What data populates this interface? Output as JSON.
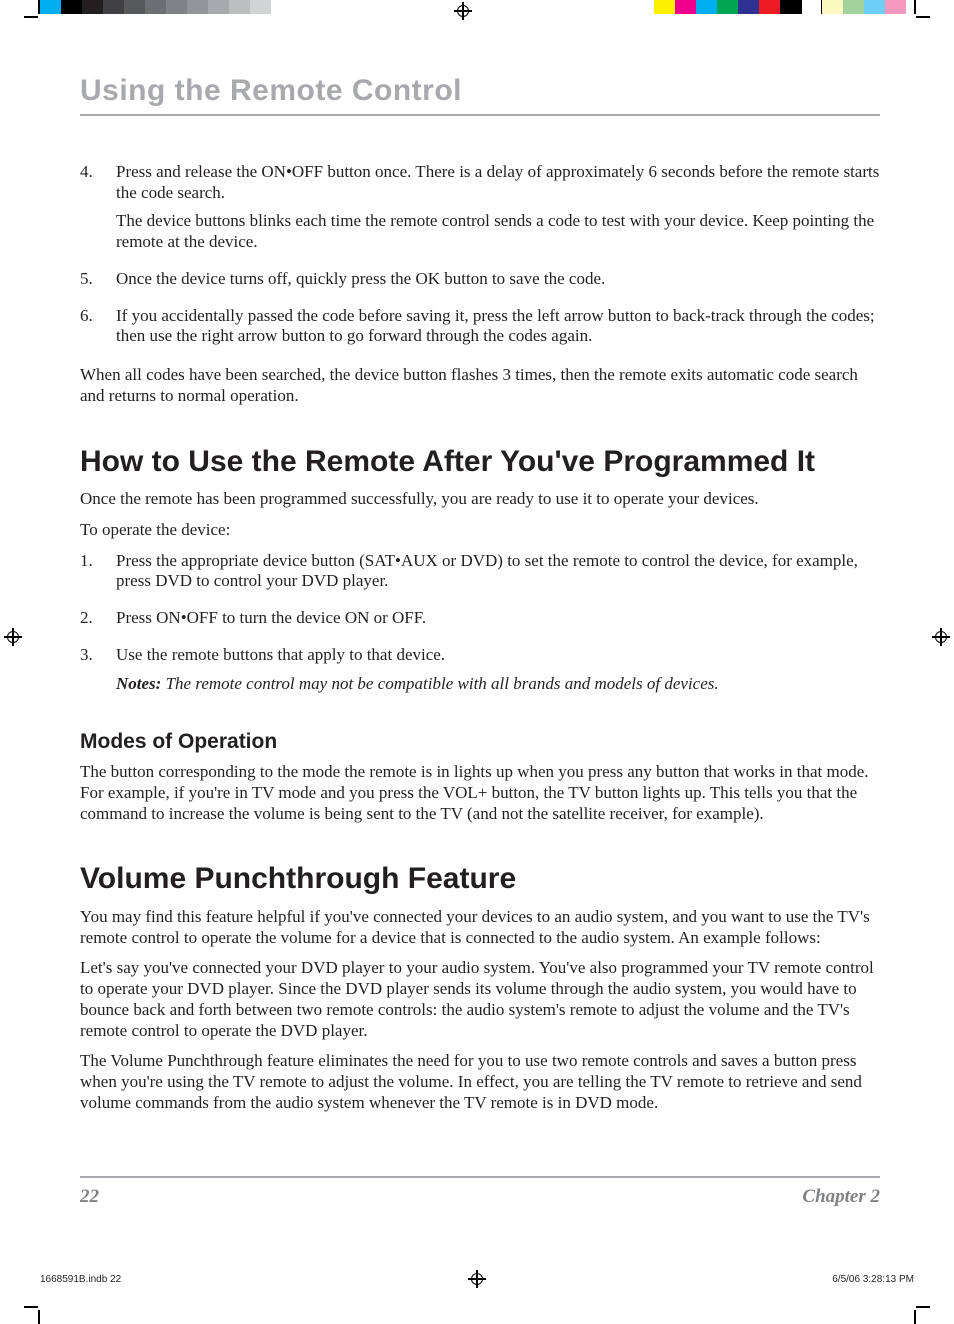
{
  "chapter_title": "Using the Remote Control",
  "list_a": [
    {
      "num": "4.",
      "paras": [
        "Press and release the ON•OFF button once. There is a delay of approximately 6 seconds before the remote starts the code search.",
        "The device buttons blinks each time the remote control sends a code to test with your device. Keep pointing the remote at the device."
      ]
    },
    {
      "num": "5.",
      "paras": [
        "Once the device turns off, quickly press the OK button to save the code."
      ]
    },
    {
      "num": "6.",
      "paras": [
        "If you accidentally passed the code before saving it, press the left arrow button to back-track through the codes; then use the right arrow button to go forward through the codes again."
      ]
    }
  ],
  "after_list_a": "When all codes have been searched, the device button flashes 3 times, then the remote exits automatic code search and returns to normal operation.",
  "section_how": {
    "title": "How to Use the Remote After You've Programmed It",
    "intro1": "Once the remote has been programmed successfully, you are ready to use it to operate your devices.",
    "intro2": "To operate the device:",
    "steps": [
      {
        "num": "1.",
        "text": "Press the appropriate device button (SAT•AUX or DVD) to set the remote to control the device, for example, press DVD to control your DVD player."
      },
      {
        "num": "2.",
        "text": "Press ON•OFF to turn the device ON or OFF."
      },
      {
        "num": "3.",
        "text": "Use the remote buttons that apply to that device."
      }
    ],
    "notes_label": "Notes:",
    "notes_body": " The remote control may not be compatible with all brands and models of devices."
  },
  "subsection_modes": {
    "title": "Modes of Operation",
    "body": "The button corresponding to the mode the remote is in lights up when you press any button that works in that mode. For example, if you're in TV mode and you press the VOL+ button, the TV button lights up. This tells you that the command to increase the volume is being sent to the TV (and not the satellite receiver, for example)."
  },
  "section_volume": {
    "title": "Volume Punchthrough Feature",
    "p1": "You may find this feature helpful if you've connected your devices to an audio system, and you want to use the TV's remote control to operate the volume for a device that is connected to the audio system. An example follows:",
    "p2": "Let's say you've connected your DVD player to your audio system. You've also programmed your TV remote control to operate your DVD player. Since the DVD player sends its volume through the audio system, you would have to bounce back and forth between two remote controls: the audio system's remote to adjust the volume and the TV's remote control to operate the DVD player.",
    "p3": "The Volume Punchthrough feature eliminates the need for you to use two remote controls and saves a button press when you're using the TV remote to adjust the volume. In effect, you are telling the TV remote to retrieve and send volume commands from the audio system whenever the TV remote is in DVD mode."
  },
  "footer": {
    "page_number": "22",
    "chapter": "Chapter 2"
  },
  "slugline": {
    "file": "1668591B.indb   22",
    "datetime": "6/5/06   3:28:13 PM"
  },
  "cal_left_colors": [
    "#00AEEF",
    "#000000",
    "#231F20",
    "#414042",
    "#58595B",
    "#6D6E71",
    "#808285",
    "#939598",
    "#A7A9AC",
    "#BCBEC0",
    "#D1D3D4",
    "#FFFFFF"
  ],
  "cal_right_colors": [
    "#FFF200",
    "#EC008C",
    "#00AEEF",
    "#00A651",
    "#2E3192",
    "#ED1C24",
    "#000000",
    "#FFFFFF",
    "#FDFAC1",
    "#A3D39C",
    "#6DCFF6",
    "#F49AC1"
  ]
}
